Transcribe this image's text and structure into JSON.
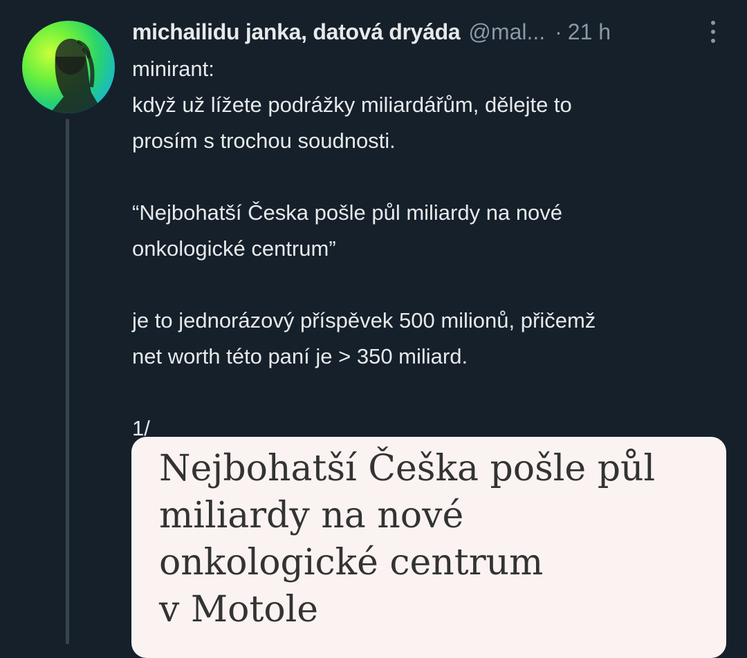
{
  "tweet": {
    "display_name": "michailidu janka, datová dryáda",
    "handle": "@mal...",
    "separator": "·",
    "time": "21 h",
    "lines": [
      "minirant:",
      "když už lížete podrážky miliardářům, dělejte to",
      "prosím s trochou soudnosti.",
      "",
      "“Nejbohatší Česka pošle půl miliardy na nové",
      "onkologické centrum”",
      "",
      "je to jednorázový příspěvek 500 milionů, přičemž",
      "net worth této paní je > 350 miliard.",
      "",
      "1/"
    ],
    "media_headline": [
      "Nejbohatší Češka pošle půl",
      "miliardy na nové",
      "onkologické centrum",
      "v Motole"
    ]
  },
  "colors": {
    "background": "#15202b",
    "primary_text": "#e7e9ea",
    "secondary_text": "#8b98a5",
    "thread_line": "#38444d",
    "card_background": "#fbf3f1",
    "headline_text": "#333333"
  },
  "icons": {
    "more": "more-vertical-icon",
    "avatar": "avatar-image"
  }
}
